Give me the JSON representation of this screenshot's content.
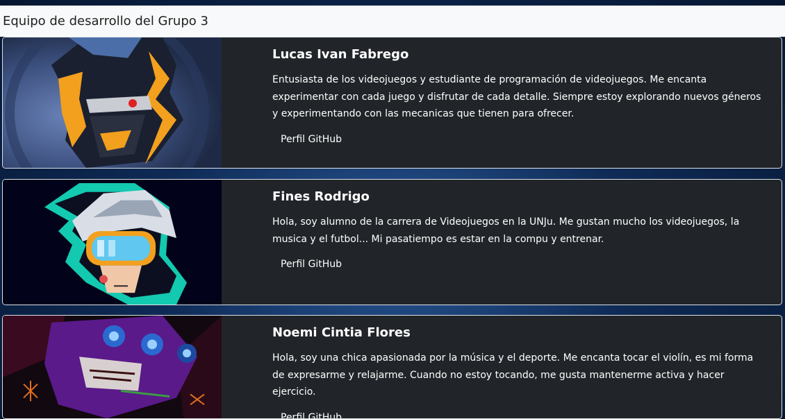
{
  "navbar": {
    "brand": "Equipo de desarrollo del Grupo 3"
  },
  "members": [
    {
      "name": "Lucas Ivan Fabrego",
      "description": "Entusiasta de los videojuegos y estudiante de programación de videojuegos. Me encanta experimentar con cada juego y disfrutar de cada detalle. Siempre estoy explorando nuevos géneros y experimentando con las mecanicas que tienen para ofrecer.",
      "link_label": "Perfil GitHub"
    },
    {
      "name": "Fines Rodrigo",
      "description": "Hola, soy alumno de la carrera de Videojuegos en la UNJu. Me gustan mucho los videojuegos, la musica y el futbol... Mi pasatiempo es estar en la compu y entrenar.",
      "link_label": "Perfil GitHub"
    },
    {
      "name": "Noemi Cintia Flores",
      "description": "Hola, soy una chica apasionada por la música y el deporte. Me encanta tocar el violín, es mi forma de expresarme y relajarme. Cuando no estoy tocando, me gusta mantenerme activa y hacer ejercicio.",
      "link_label": "Perfil GitHub"
    }
  ]
}
